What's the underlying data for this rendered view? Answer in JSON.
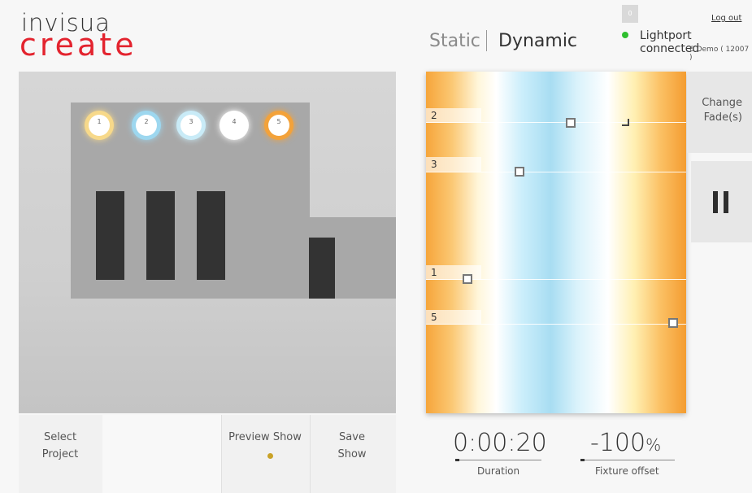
{
  "logo": {
    "top": "invisua",
    "bottom": "create"
  },
  "mode": {
    "static": "Static",
    "dynamic": "Dynamic"
  },
  "account": {
    "badge": "0",
    "logout": "Log out",
    "status": "Lightport connected",
    "device": "6 Demo ( 12007 )"
  },
  "stage": {
    "fixtures": [
      {
        "number": "1",
        "color": "#f7d98a"
      },
      {
        "number": "2",
        "color": "#9dd7ef"
      },
      {
        "number": "3",
        "color": "#c9ebf7"
      },
      {
        "number": "4",
        "color": "#ffffff"
      },
      {
        "number": "5",
        "color": "#f3a23a"
      }
    ]
  },
  "timeline": {
    "tracks": [
      {
        "label": "2"
      },
      {
        "label": "3"
      },
      {
        "label": "1"
      },
      {
        "label": "5"
      }
    ]
  },
  "actions": {
    "change_fade": "Change Fade(s)",
    "pause_icon": "pause-icon"
  },
  "bottom": {
    "select_project": "Select Project",
    "preview_show": "Preview Show",
    "save_show": "Save Show"
  },
  "duration": {
    "value": "0:00:20",
    "label": "Duration"
  },
  "offset": {
    "value": "-100",
    "unit": "%",
    "label": "Fixture offset"
  },
  "colors": {
    "brand": "#e3232e",
    "status_ok": "#2fbf2f",
    "preview_dot": "#c9a227"
  }
}
